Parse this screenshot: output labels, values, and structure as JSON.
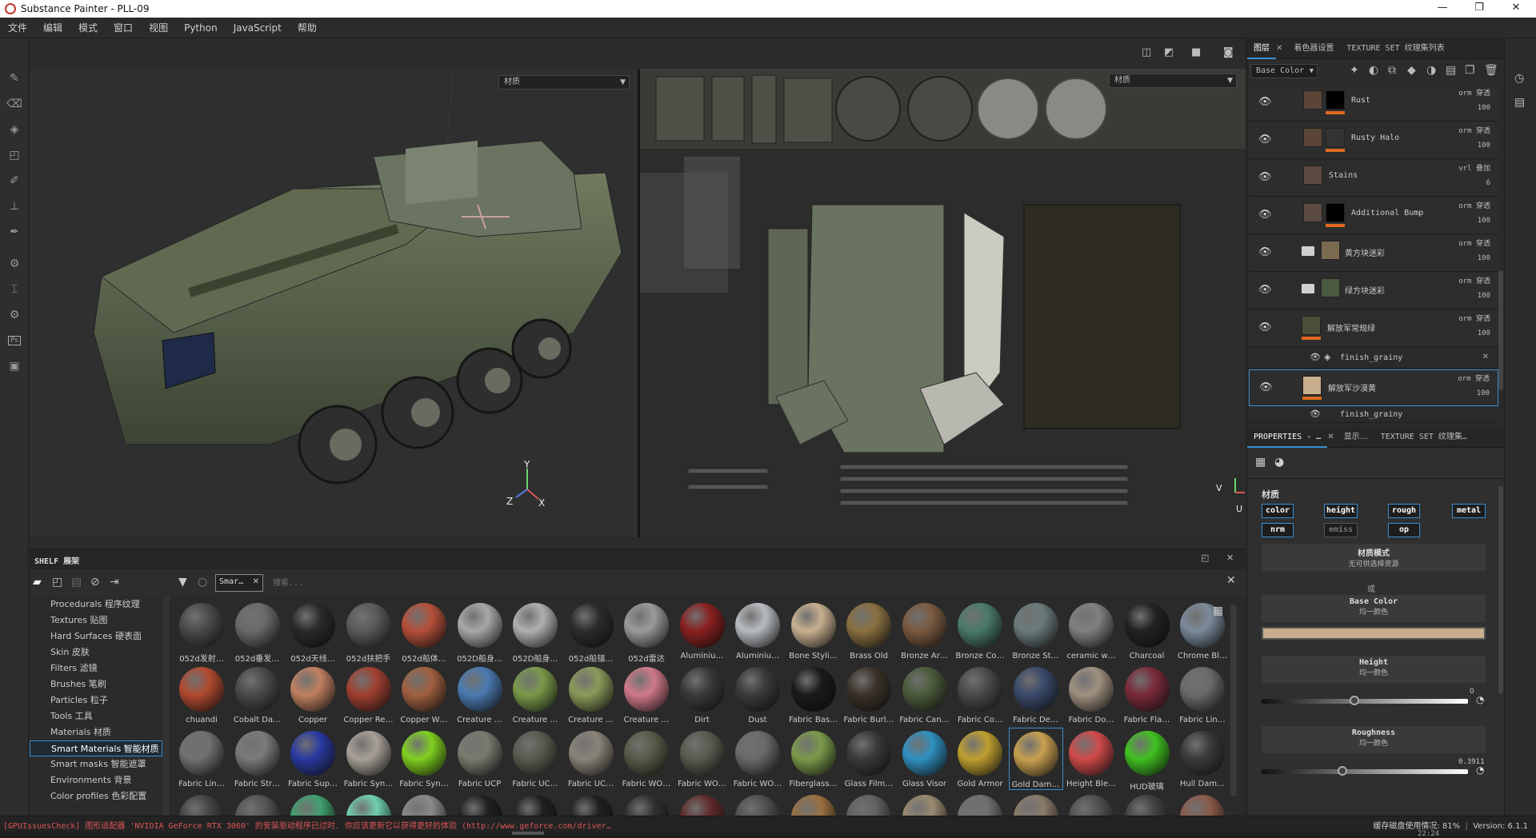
{
  "window": {
    "title": "Substance Painter - PLL-09",
    "minimize": "—",
    "maximize": "❐",
    "close": "✕"
  },
  "menu": [
    "文件",
    "编辑",
    "模式",
    "窗口",
    "视图",
    "Python",
    "JavaScript",
    "帮助"
  ],
  "viewport": {
    "left_select": "材质",
    "right_select": "材质",
    "axis_y": "Y",
    "axis_z": "Z",
    "axis_x": "X",
    "uv_axis_y": "V",
    "uv_axis_u": "U"
  },
  "layers_panel": {
    "tabs": [
      "图层",
      "着色器设置",
      "TEXTURE SET 纹理集列表"
    ],
    "channel_select": "Base Color",
    "layers": [
      {
        "name": "Rust",
        "blend": "orm 穿透",
        "opacity": "100"
      },
      {
        "name": "Rusty Halo",
        "blend": "orm 穿透",
        "opacity": "100"
      },
      {
        "name": "Stains",
        "blend": "vrl 叠加",
        "opacity": "6"
      },
      {
        "name": "Additional Bump",
        "blend": "orm 穿透",
        "opacity": "100"
      },
      {
        "name": "黄方块迷彩",
        "blend": "orm 穿透",
        "opacity": "100"
      },
      {
        "name": "绿方块迷彩",
        "blend": "orm 穿透",
        "opacity": "100"
      },
      {
        "name": "解放军常规绿",
        "blend": "orm 穿透",
        "opacity": "100"
      },
      {
        "name": "解放军沙漠黄",
        "blend": "orm 穿透",
        "opacity": "100"
      }
    ],
    "sub_effect": "finish_grainy",
    "sub_effect_cut": "finish_grainy"
  },
  "properties_panel": {
    "tabs": [
      "PROPERTIES - …",
      "显示…",
      "TEXTURE SET 纹理集…"
    ],
    "section": "材质",
    "channels": [
      "color",
      "height",
      "rough",
      "metal",
      "nrm",
      "emiss",
      "op"
    ],
    "material_mode_title": "材质模式",
    "material_mode_value": "无可供选择资源",
    "or_text": "或",
    "base_color_title": "Base Color",
    "base_color_sub": "均一颜色",
    "base_color_hex": "#c8ae8c",
    "height_title": "Height",
    "height_sub": "均一颜色",
    "height_value": "0",
    "height_fraction": 0.45,
    "roughness_title": "Roughness",
    "roughness_sub": "均一颜色",
    "roughness_value": "0.3911",
    "roughness_fraction": 0.3911
  },
  "shelf": {
    "title": "SHELF 展架",
    "filter_tag": "Smar…",
    "search_placeholder": "搜索...",
    "categories": [
      {
        "label": "Procedurals 程序纹理",
        "selected": false
      },
      {
        "label": "Textures 贴图",
        "selected": false
      },
      {
        "label": "Hard Surfaces 硬表面",
        "selected": false
      },
      {
        "label": "Skin 皮肤",
        "selected": false
      },
      {
        "label": "Filters 滤镜",
        "selected": false
      },
      {
        "label": "Brushes 笔刷",
        "selected": false
      },
      {
        "label": "Particles 粒子",
        "selected": false
      },
      {
        "label": "Tools 工具",
        "selected": false
      },
      {
        "label": "Materials 材质",
        "selected": false
      },
      {
        "label": "Smart Materials 智能材质",
        "selected": true
      },
      {
        "label": "Smart masks 智能遮罩",
        "selected": false
      },
      {
        "label": "Environments 背景",
        "selected": false
      },
      {
        "label": "Color profiles 色彩配置",
        "selected": false
      }
    ],
    "materials": [
      {
        "label": "052d发射…",
        "color": "#4a4a4a"
      },
      {
        "label": "052d垂发…",
        "color": "#6a6a68"
      },
      {
        "label": "052d天线…",
        "color": "#2a2a2a"
      },
      {
        "label": "052d扶把手",
        "color": "#5a5a5a"
      },
      {
        "label": "052d船体…",
        "color": "#b5503a"
      },
      {
        "label": "052D船身…",
        "color": "#a8a8a8"
      },
      {
        "label": "052D船身…",
        "color": "#b0b0b0"
      },
      {
        "label": "052d船锚…",
        "color": "#2c2c2c"
      },
      {
        "label": "052d雷达",
        "color": "#9a9a9a"
      },
      {
        "label": "Aluminiu…",
        "color": "#8a2020"
      },
      {
        "label": "Aluminiu…",
        "color": "#b8bcc0"
      },
      {
        "label": "Bone Styli…",
        "color": "#c8b090"
      },
      {
        "label": "Brass Old",
        "color": "#8a7040"
      },
      {
        "label": "Bronze Ar…",
        "color": "#7a5a40"
      },
      {
        "label": "Bronze Co…",
        "color": "#4a7a6a"
      },
      {
        "label": "Bronze St…",
        "color": "#6a7a7a"
      },
      {
        "label": "ceramic w…",
        "color": "#808080"
      },
      {
        "label": "Charcoal",
        "color": "#222222"
      },
      {
        "label": "Chrome Bl…",
        "color": "#7a8a9a"
      },
      {
        "label": "chuandi",
        "color": "#b04a30"
      },
      {
        "label": "Cobalt Da…",
        "color": "#4a4a48"
      },
      {
        "label": "Copper",
        "color": "#c08060"
      },
      {
        "label": "Copper Re…",
        "color": "#a04030"
      },
      {
        "label": "Copper W…",
        "color": "#a06040"
      },
      {
        "label": "Creature …",
        "color": "#4a7ab0"
      },
      {
        "label": "Creature …",
        "color": "#7a9a4a"
      },
      {
        "label": "Creature …",
        "color": "#8a9a5a"
      },
      {
        "label": "Creature …",
        "color": "#d07a8a"
      },
      {
        "label": "Dirt",
        "color": "#3a3a3a"
      },
      {
        "label": "Dust",
        "color": "#3a3a3a"
      },
      {
        "label": "Fabric Bas…",
        "color": "#1a1a1a"
      },
      {
        "label": "Fabric Burl…",
        "color": "#3a3228"
      },
      {
        "label": "Fabric Can…",
        "color": "#4a5a3a"
      },
      {
        "label": "Fabric Co…",
        "color": "#4a4a4a"
      },
      {
        "label": "Fabric De…",
        "color": "#3a4a6a"
      },
      {
        "label": "Fabric Do…",
        "color": "#a09080"
      },
      {
        "label": "Fabric Fla…",
        "color": "#7a2a3a"
      },
      {
        "label": "Fabric Lin…",
        "color": "#6a6a6a"
      },
      {
        "label": "Fabric Lin…",
        "color": "#707070"
      },
      {
        "label": "Fabric Str…",
        "color": "#7a7a7a"
      },
      {
        "label": "Fabric Sup…",
        "color": "#2a3aa0"
      },
      {
        "label": "Fabric Syn…",
        "color": "#a8a098"
      },
      {
        "label": "Fabric Syn…",
        "color": "#80d020"
      },
      {
        "label": "Fabric UCP",
        "color": "#7a7a70"
      },
      {
        "label": "Fabric UC…",
        "color": "#5a5a50"
      },
      {
        "label": "Fabric UC…",
        "color": "#8a8478"
      },
      {
        "label": "Fabric WO…",
        "color": "#5a5a48"
      },
      {
        "label": "Fabric WO…",
        "color": "#5a5a50"
      },
      {
        "label": "Fabric WO…",
        "color": "#6a6a68"
      },
      {
        "label": "Fiberglass…",
        "color": "#7a9a4a"
      },
      {
        "label": "Glass Film…",
        "color": "#3a3a3a"
      },
      {
        "label": "Glass Visor",
        "color": "#3090c0"
      },
      {
        "label": "Gold Armor",
        "color": "#c0a030"
      },
      {
        "label": "Gold Dam…",
        "color": "#c8a050"
      },
      {
        "label": "Height Ble…",
        "color": "#d04a4a"
      },
      {
        "label": "HUD玻璃",
        "color": "#40c020"
      },
      {
        "label": "Hull Dam…",
        "color": "#3a3a3a"
      }
    ],
    "selected_material_index": 53,
    "row4_colors": [
      "#444444",
      "#555555",
      "#40a070",
      "#70d0b0",
      "#8a8a8a",
      "#202020",
      "#202020",
      "#202020",
      "#303030",
      "#602a2a",
      "#505050",
      "#9a7040",
      "#606060",
      "#9a8a70",
      "#707070",
      "#8a7a6a",
      "#505050",
      "#404040",
      "#8a5a4a"
    ]
  },
  "status": {
    "warning": "[GPUIssuesCheck] 图形适配器 'NVIDIA GeForce RTX 3060' 的安装驱动程序已过时. 你应该更新它以获得更好的体验 (http://www.geforce.com/driver…",
    "cache": "缓存磁盘使用情况:  81%",
    "version": "Version: 6.1.1",
    "partial": "22:24"
  }
}
